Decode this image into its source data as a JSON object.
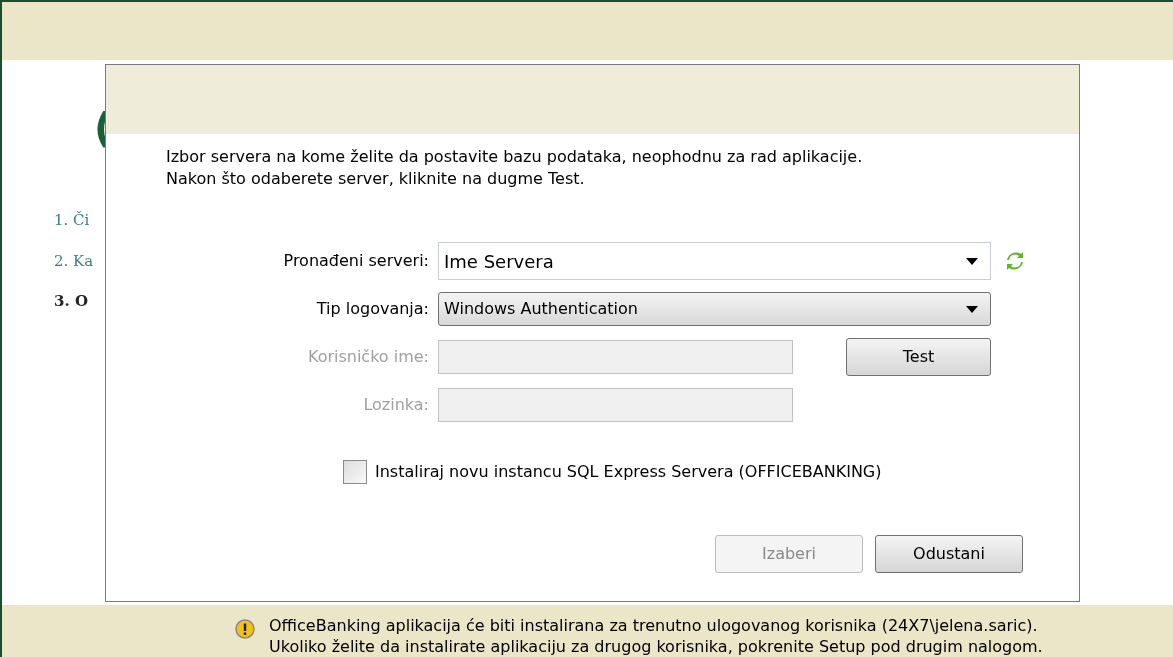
{
  "background": {
    "heading_fragment": "(",
    "steps": [
      {
        "label": "1. Či",
        "selected": false
      },
      {
        "label": "2. Ka",
        "selected": false
      },
      {
        "label": "3. O",
        "selected": true
      }
    ]
  },
  "dialog": {
    "intro": [
      "Izbor servera na kome želite da postavite bazu podataka, neophodnu za rad aplikacije.",
      "Nakon što odaberete server, kliknite na dugme Test."
    ],
    "server": {
      "label": "Pronađeni serveri:",
      "value": "Ime Servera"
    },
    "login_type": {
      "label": "Tip logovanja:",
      "value": "Windows Authentication"
    },
    "username": {
      "label": "Korisničko ime:",
      "disabled": true
    },
    "password": {
      "label": "Lozinka:",
      "disabled": true
    },
    "test_button": "Test",
    "install_checkbox": {
      "label": "Instaliraj novu instancu SQL Express Servera (OFFICEBANKING)",
      "checked": false
    },
    "buttons": [
      {
        "label": "Izaberi",
        "disabled": true
      },
      {
        "label": "Odustani",
        "disabled": false
      }
    ]
  },
  "notice": [
    "OfficeBanking aplikacija će biti instalirana  za trenutno ulogovanog korisnika (24X7\\jelena.saric).",
    "Ukoliko želite da instalirate aplikaciju za drugog korisnika, pokrenite Setup pod drugim nalogom."
  ]
}
